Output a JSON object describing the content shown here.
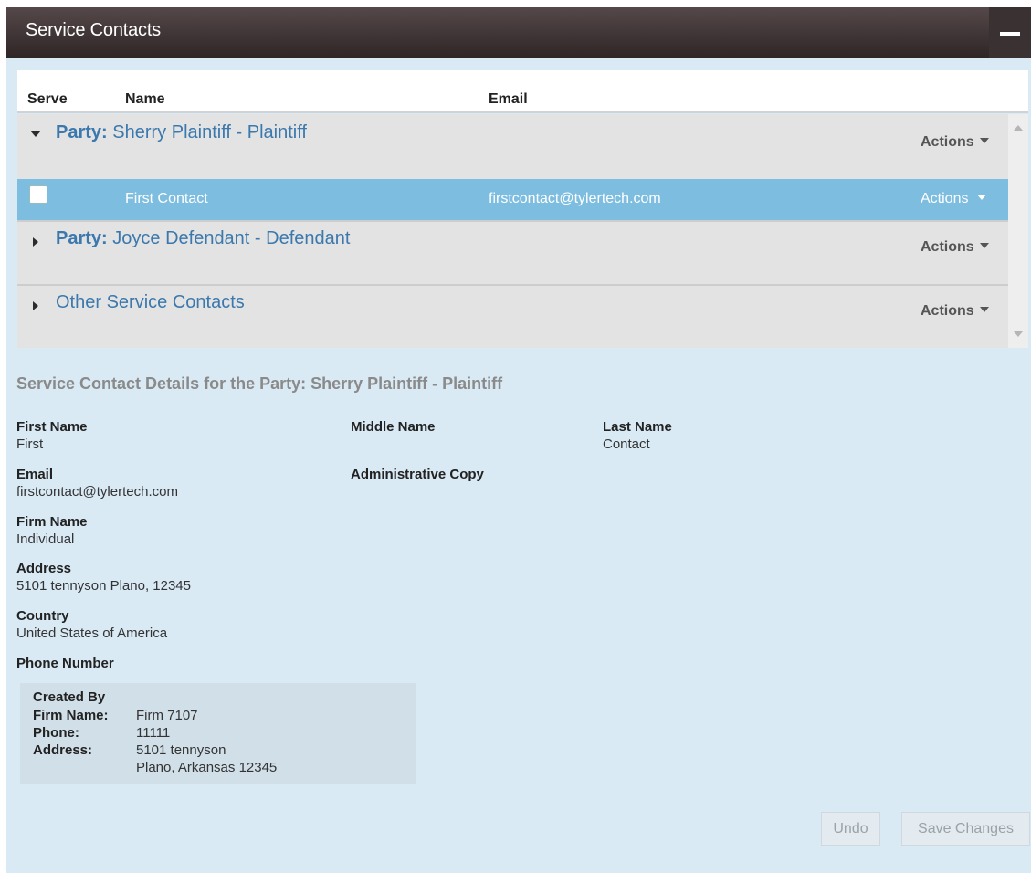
{
  "panel": {
    "title": "Service Contacts"
  },
  "columns": {
    "serve": "Serve",
    "name": "Name",
    "email": "Email"
  },
  "groups": [
    {
      "prefix": "Party:",
      "label": "Sherry Plaintiff - Plaintiff",
      "expanded": true,
      "actions": "Actions"
    },
    {
      "prefix": "Party:",
      "label": "Joyce Defendant - Defendant",
      "expanded": false,
      "actions": "Actions"
    },
    {
      "prefix": "",
      "label": "Other Service Contacts",
      "expanded": false,
      "actions": "Actions"
    }
  ],
  "contact": {
    "checked": false,
    "name": "First Contact",
    "email": "firstcontact@tylertech.com",
    "actions": "Actions"
  },
  "details": {
    "title": "Service Contact Details for the Party: Sherry Plaintiff - Plaintiff",
    "first_name": {
      "label": "First Name",
      "value": "First"
    },
    "middle_name": {
      "label": "Middle Name",
      "value": ""
    },
    "last_name": {
      "label": "Last Name",
      "value": "Contact"
    },
    "email": {
      "label": "Email",
      "value": "firstcontact@tylertech.com"
    },
    "admin_copy": {
      "label": "Administrative Copy",
      "value": ""
    },
    "firm_name": {
      "label": "Firm Name",
      "value": "Individual"
    },
    "address": {
      "label": "Address",
      "value": "5101 tennyson Plano, 12345"
    },
    "country": {
      "label": "Country",
      "value": "United States of America"
    },
    "phone": {
      "label": "Phone Number",
      "value": ""
    }
  },
  "created_by": {
    "title": "Created By",
    "firm_label": "Firm Name:",
    "firm_value": "Firm 7107",
    "phone_label": "Phone:",
    "phone_value": "11111",
    "address_label": "Address:",
    "address_line1": "5101 tennyson",
    "address_line2": "Plano, Arkansas 12345"
  },
  "buttons": {
    "undo": "Undo",
    "save": "Save Changes"
  },
  "colors": {
    "header_bg": "#3e3536",
    "selected_row": "#7dbde0",
    "link_blue": "#3b78ad",
    "panel_bg": "#d9eaf5"
  }
}
